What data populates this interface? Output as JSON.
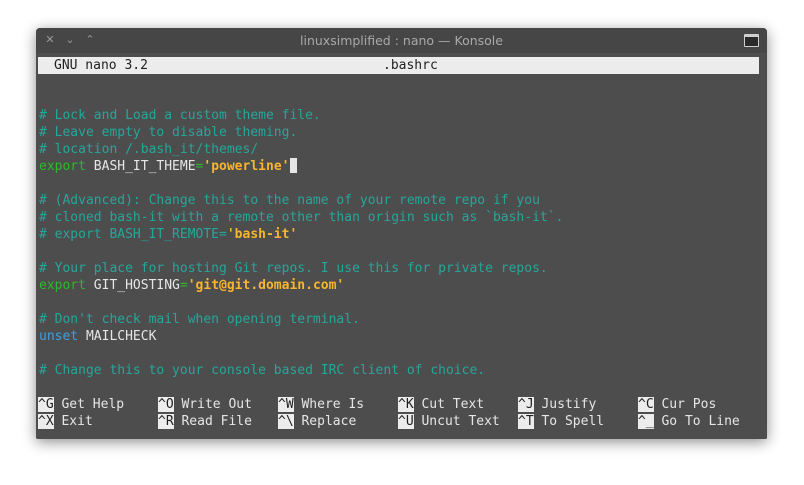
{
  "window": {
    "title": "linuxsimplified : nano — Konsole",
    "buttons": {
      "close": "✕",
      "minimize": "⌄",
      "maximize": "⌃"
    }
  },
  "nano": {
    "version": "GNU nano 3.2",
    "filename": ".bashrc"
  },
  "lines": {
    "l1": "# Lock and Load a custom theme file.",
    "l2": "# Leave empty to disable theming.",
    "l3": "# location /.bash_it/themes/",
    "l4_kw": "export",
    "l4_var": " BASH_IT_THEME",
    "l4_eq": "=",
    "l4_val": "'powerline'",
    "l6": "# (Advanced): Change this to the name of your remote repo if you",
    "l7": "# cloned bash-it with a remote other than origin such as `bash-it`.",
    "l8": "# export BASH_IT_REMOTE=",
    "l8_val": "'bash-it'",
    "l10": "# Your place for hosting Git repos. I use this for private repos.",
    "l11_kw": "export",
    "l11_var": " GIT_HOSTING",
    "l11_eq": "=",
    "l11_val": "'git@git.domain.com'",
    "l13": "# Don't check mail when opening terminal.",
    "l14_kw": "unset",
    "l14_var": " MAILCHECK",
    "l16": "# Change this to your console based IRC client of choice."
  },
  "shortcuts": [
    {
      "key": "^G",
      "label": " Get Help"
    },
    {
      "key": "^O",
      "label": " Write Out"
    },
    {
      "key": "^W",
      "label": " Where Is"
    },
    {
      "key": "^K",
      "label": " Cut Text"
    },
    {
      "key": "^J",
      "label": " Justify"
    },
    {
      "key": "^C",
      "label": " Cur Pos"
    },
    {
      "key": "^X",
      "label": " Exit"
    },
    {
      "key": "^R",
      "label": " Read File"
    },
    {
      "key": "^\\",
      "label": " Replace"
    },
    {
      "key": "^U",
      "label": " Uncut Text"
    },
    {
      "key": "^T",
      "label": " To Spell"
    },
    {
      "key": "^_",
      "label": " Go To Line"
    }
  ],
  "colors": {
    "comment": "#26a69a",
    "keyword_export": "#2bba2b",
    "keyword_unset": "#3f9fe0",
    "string": "#f5b52e",
    "terminal_bg": "#4d4d4d"
  }
}
